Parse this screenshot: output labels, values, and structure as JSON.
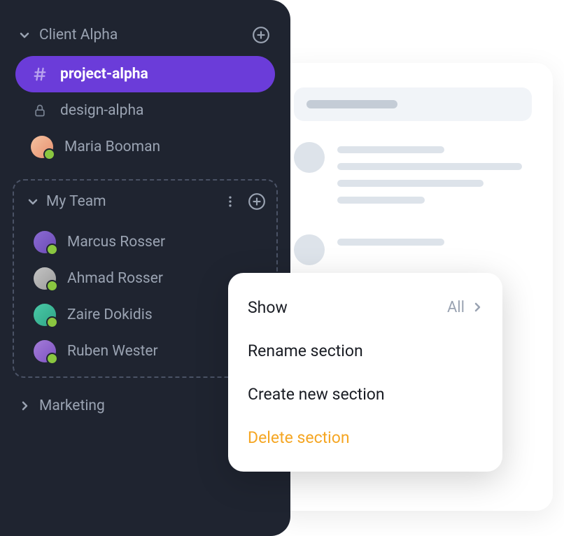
{
  "sidebar": {
    "sections": [
      {
        "title": "Client Alpha",
        "expanded": true,
        "items": [
          {
            "kind": "channel",
            "label": "project-alpha",
            "active": true
          },
          {
            "kind": "private",
            "label": "design-alpha"
          },
          {
            "kind": "user",
            "label": "Maria Booman",
            "avatarClass": "av1",
            "presence": "online"
          }
        ]
      },
      {
        "title": "My Team",
        "expanded": true,
        "highlighted": true,
        "items": [
          {
            "kind": "user",
            "label": "Marcus Rosser",
            "avatarClass": "av2",
            "presence": "online"
          },
          {
            "kind": "user",
            "label": "Ahmad Rosser",
            "avatarClass": "av3",
            "presence": "online"
          },
          {
            "kind": "user",
            "label": "Zaire Dokidis",
            "avatarClass": "av4",
            "presence": "online"
          },
          {
            "kind": "user",
            "label": "Ruben Wester",
            "avatarClass": "av5",
            "presence": "online"
          }
        ]
      },
      {
        "title": "Marketing",
        "expanded": false
      }
    ]
  },
  "contextMenu": {
    "items": [
      {
        "label": "Show",
        "value": "All",
        "hasChevron": true
      },
      {
        "label": "Rename section"
      },
      {
        "label": "Create new section"
      },
      {
        "label": "Delete section",
        "danger": true
      }
    ]
  }
}
